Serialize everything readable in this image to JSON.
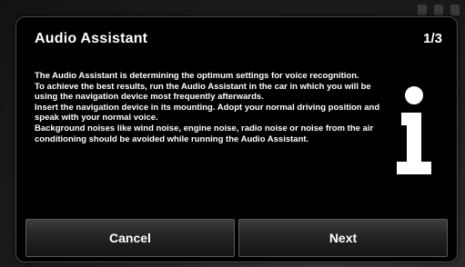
{
  "dialog": {
    "title": "Audio Assistant",
    "page_counter": "1/3",
    "paragraphs": [
      "The Audio Assistant is determining the optimum settings for voice recognition.",
      "To achieve the best results, run the Audio Assistant in the car in which you will be using the navigation device most frequently afterwards.",
      "Insert the navigation device in its mounting. Adopt your normal driving position and speak with your normal voice.",
      "Background noises like wind noise, engine noise, radio noise or noise from the air conditioning should be avoided while running the Audio Assistant."
    ],
    "icon": "info-icon"
  },
  "buttons": {
    "cancel_label": "Cancel",
    "next_label": "Next"
  },
  "colors": {
    "dialog_background": "#000000",
    "text": "#ffffff",
    "button_top": "#3c3c3c",
    "button_bottom": "#141414",
    "border": "#4a4a4a"
  }
}
